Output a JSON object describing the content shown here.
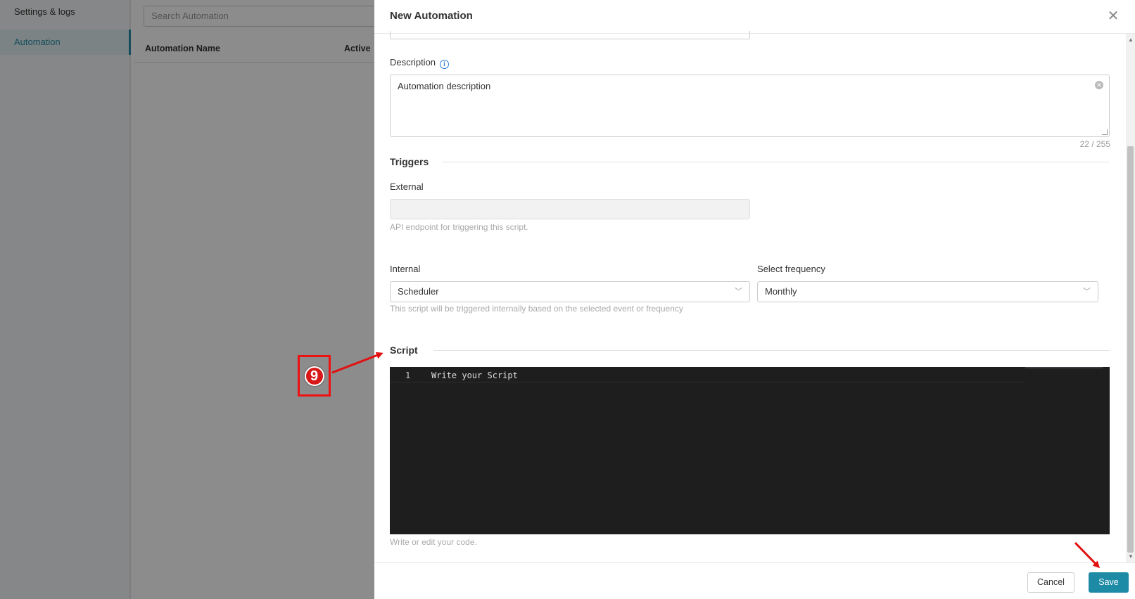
{
  "background": {
    "sidebar": {
      "items": [
        {
          "label": "Settings & logs"
        },
        {
          "label": "Automation"
        }
      ]
    },
    "search": {
      "placeholder": "Search Automation"
    },
    "table": {
      "columns": [
        "Automation Name",
        "Active"
      ]
    }
  },
  "annotation": {
    "step_number": "9",
    "arrow_color": "#e11111"
  },
  "drawer": {
    "title": "New Automation",
    "close_icon": "close-icon",
    "description": {
      "label": "Description",
      "value": "Automation description",
      "char_count": "22 / 255"
    },
    "triggers": {
      "title": "Triggers",
      "external": {
        "label": "External",
        "value": "",
        "hint": "API endpoint for triggering this script."
      },
      "internal": {
        "label": "Internal",
        "value": "Scheduler",
        "hint": "This script will be triggered internally based on the selected event or frequency"
      },
      "frequency": {
        "label": "Select frequency",
        "value": "Monthly"
      }
    },
    "script": {
      "title": "Script",
      "lines": [
        {
          "number": "1",
          "text": "Write your Script"
        }
      ],
      "hint": "Write or edit your code."
    },
    "footer": {
      "cancel_label": "Cancel",
      "save_label": "Save"
    }
  },
  "colors": {
    "accent": "#1d8aa6",
    "editor_bg": "#1e1e1e",
    "annotation": "#e11111"
  }
}
